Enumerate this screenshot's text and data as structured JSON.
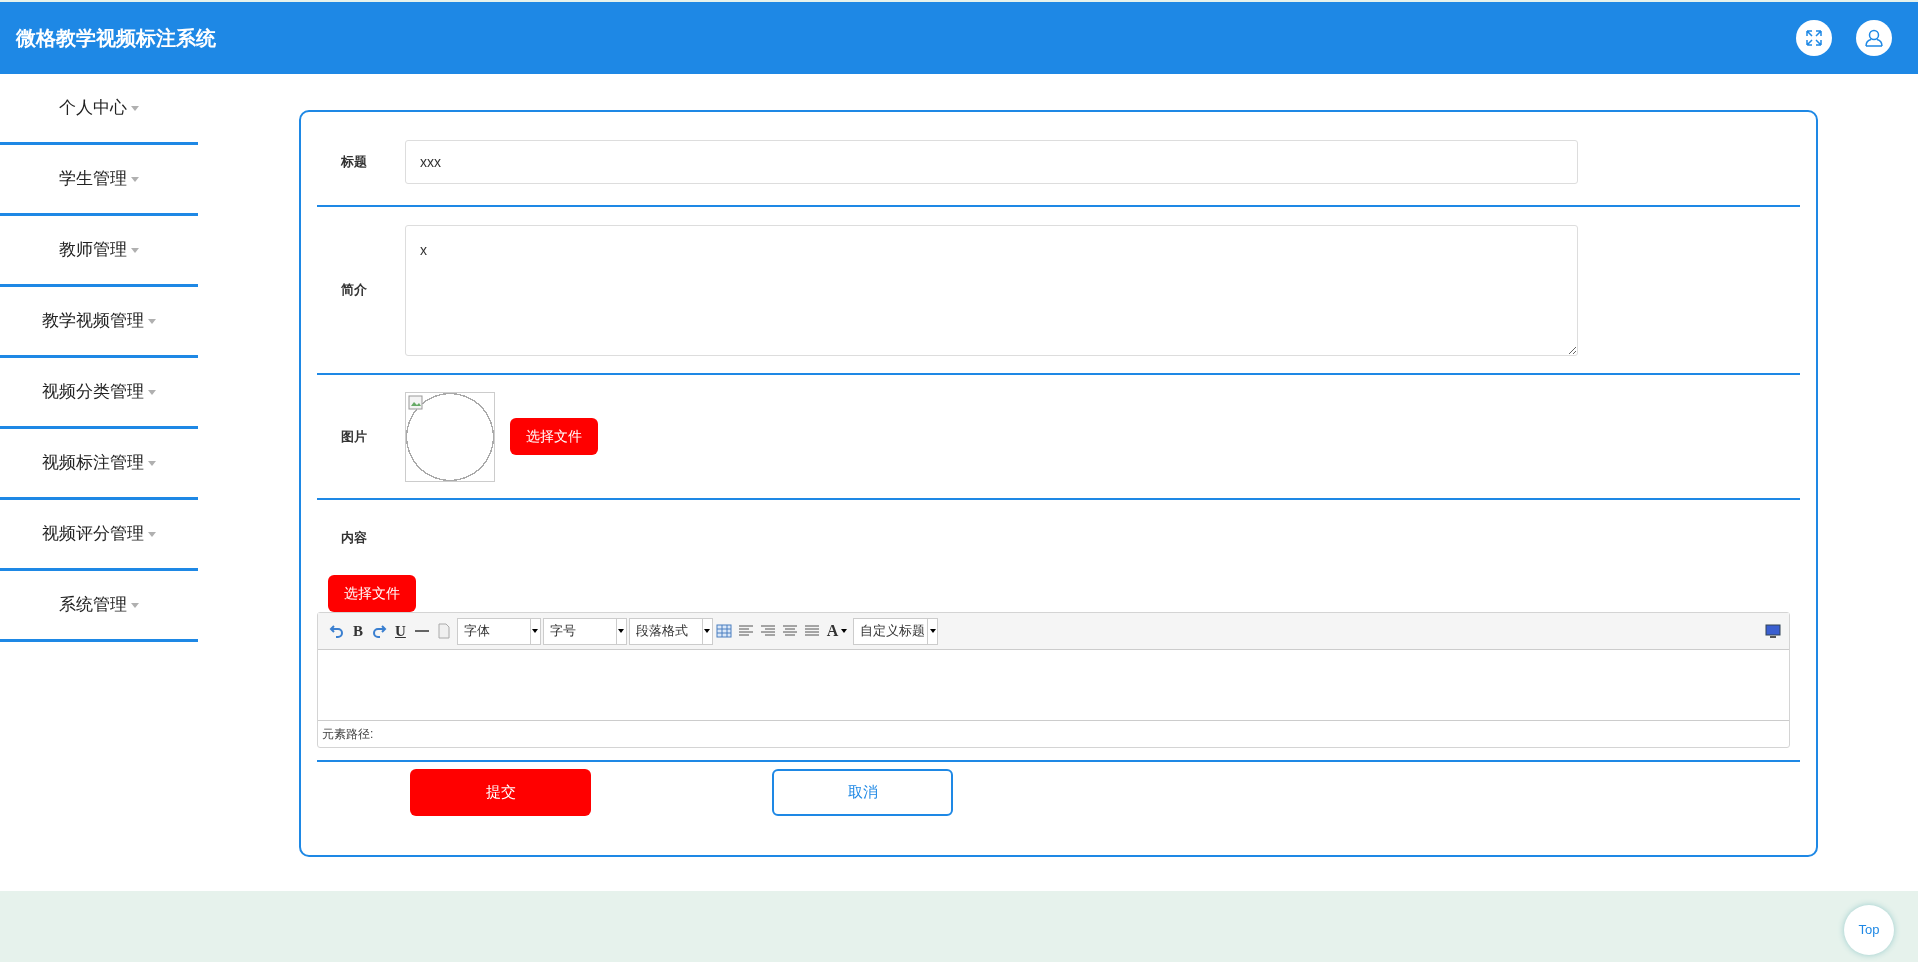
{
  "header": {
    "title": "微格教学视频标注系统"
  },
  "sidebar": {
    "items": [
      {
        "label": "个人中心"
      },
      {
        "label": "学生管理"
      },
      {
        "label": "教师管理"
      },
      {
        "label": "教学视频管理"
      },
      {
        "label": "视频分类管理"
      },
      {
        "label": "视频标注管理"
      },
      {
        "label": "视频评分管理"
      },
      {
        "label": "系统管理"
      }
    ]
  },
  "form": {
    "title": {
      "label": "标题",
      "value": "xxx"
    },
    "intro": {
      "label": "简介",
      "value": "x"
    },
    "image": {
      "label": "图片",
      "button": "选择文件"
    },
    "content": {
      "label": "内容",
      "button": "选择文件",
      "editor": {
        "bold": "B",
        "underline": "U",
        "selects": [
          "字体",
          "字号",
          "段落格式"
        ],
        "font_color": "A",
        "custom_select": "自定义标题",
        "path_label": "元素路径:"
      }
    },
    "submit": "提交",
    "cancel": "取消"
  },
  "top_button": "Top"
}
